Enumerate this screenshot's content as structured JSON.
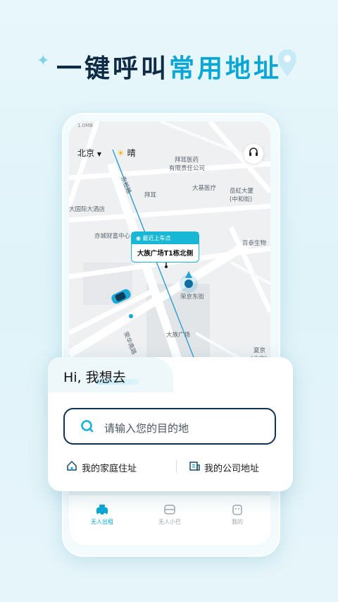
{
  "headline": {
    "part1": "一键呼叫",
    "part2": "常用地址"
  },
  "status_bar": {
    "text": "1.0MB"
  },
  "map": {
    "city": "北京",
    "weather": "晴",
    "labels": {
      "l1": "拜耳医药",
      "l2": "有限责任公司",
      "l3": "大基医疗",
      "l4": "岳虹大厦",
      "l5": "(中和街)",
      "l6": "拜耳",
      "l7": "大国际大酒店",
      "l8": "亦城财富中心",
      "l9": "百泰生物",
      "l10": "荣京东街",
      "l11": "大族广场",
      "l12": "荣华南路",
      "l13": "夏京",
      "l14": "(北京)",
      "l15": "东桩路"
    },
    "pickup": {
      "header": "最近上车点",
      "name": "大族广场T1栋北侧"
    }
  },
  "card": {
    "greeting": "Hi, 我想去",
    "search_placeholder": "请输入您的目的地",
    "home_label": "我的家庭住址",
    "company_label": "我的公司地址"
  },
  "tabs": [
    {
      "label": "无人出租"
    },
    {
      "label": "无人小巴"
    },
    {
      "label": "我的"
    }
  ],
  "colors": {
    "accent": "#0aa7d6",
    "dark": "#0e2a45",
    "pickup": "#19b7d6"
  }
}
